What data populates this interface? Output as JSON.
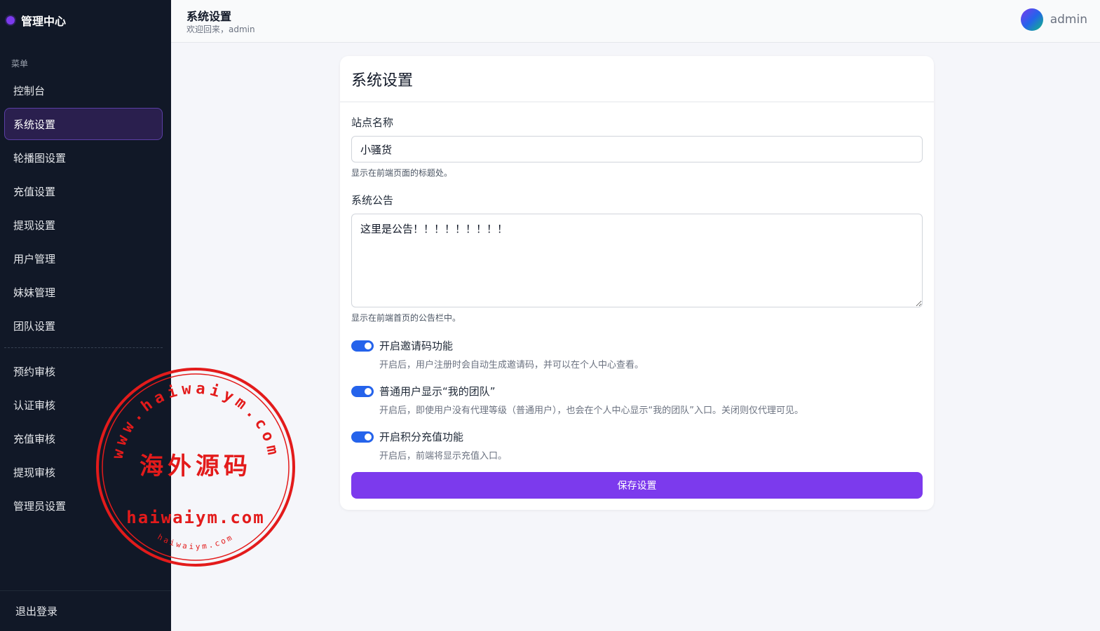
{
  "brand": {
    "name": "管理中心"
  },
  "sidebar": {
    "heading": "菜单",
    "items": [
      {
        "label": "控制台"
      },
      {
        "label": "系统设置",
        "active": true
      },
      {
        "label": "轮播图设置"
      },
      {
        "label": "充值设置"
      },
      {
        "label": "提现设置"
      },
      {
        "label": "用户管理"
      },
      {
        "label": "妹妹管理"
      },
      {
        "label": "团队设置"
      }
    ],
    "items2": [
      {
        "label": "预约审核"
      },
      {
        "label": "认证审核"
      },
      {
        "label": "充值审核"
      },
      {
        "label": "提现审核"
      },
      {
        "label": "管理员设置"
      }
    ],
    "logout": "退出登录"
  },
  "header": {
    "title": "系统设置",
    "subtitle": "欢迎回来，admin",
    "username": "admin"
  },
  "card": {
    "title": "系统设置",
    "site_name": {
      "label": "站点名称",
      "value": "小骚货",
      "help": "显示在前端页面的标题处。"
    },
    "notice": {
      "label": "系统公告",
      "value": "这里是公告！！！！！！！！！",
      "help": "显示在前端首页的公告栏中。"
    },
    "toggles": [
      {
        "label": "开启邀请码功能",
        "help": "开启后，用户注册时会自动生成邀请码，并可以在个人中心查看。",
        "on": true
      },
      {
        "label": "普通用户显示“我的团队”",
        "help": "开启后，即使用户没有代理等级（普通用户），也会在个人中心显示“我的团队”入口。关闭则仅代理可见。",
        "on": true
      },
      {
        "label": "开启积分充值功能",
        "help": "开启后，前端将显示充值入口。",
        "on": true
      }
    ],
    "save_label": "保存设置"
  },
  "watermark": {
    "arc_text": "www.haiwaiym.com",
    "center_text": "海外源码",
    "bottom_text": "haiwaiym.com",
    "small_text": "haiwaiym.com",
    "color": "#e31b1b"
  },
  "colors": {
    "sidebar_bg": "#111827",
    "accent": "#7c3aed",
    "toggle_on": "#2563eb"
  }
}
